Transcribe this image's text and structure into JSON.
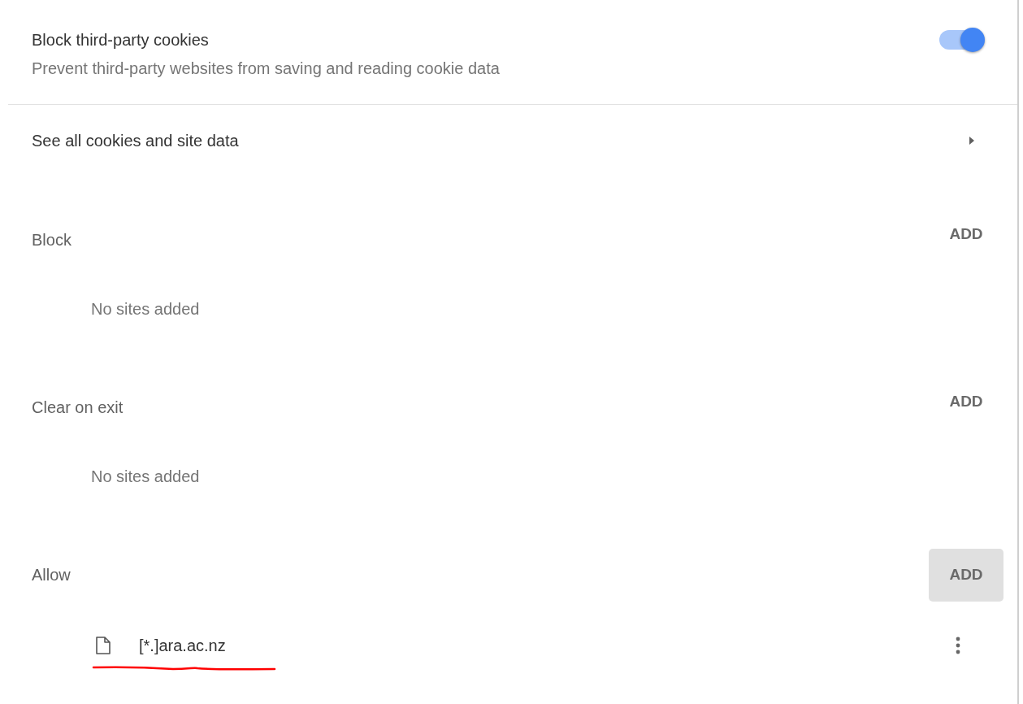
{
  "third_party": {
    "title": "Block third-party cookies",
    "description": "Prevent third-party websites from saving and reading cookie data",
    "on": true
  },
  "see_all": {
    "label": "See all cookies and site data"
  },
  "sections": [
    {
      "title": "Block",
      "add": {
        "label": "ADD",
        "hovered": false
      },
      "empty_text": "No sites added"
    },
    {
      "title": "Clear on exit",
      "add": {
        "label": "ADD",
        "hovered": false
      },
      "empty_text": "No sites added"
    },
    {
      "title": "Allow",
      "add": {
        "label": "ADD",
        "hovered": true
      },
      "sites": [
        {
          "pattern": "[*.]ara.ac.nz",
          "underlined": true
        }
      ]
    }
  ]
}
